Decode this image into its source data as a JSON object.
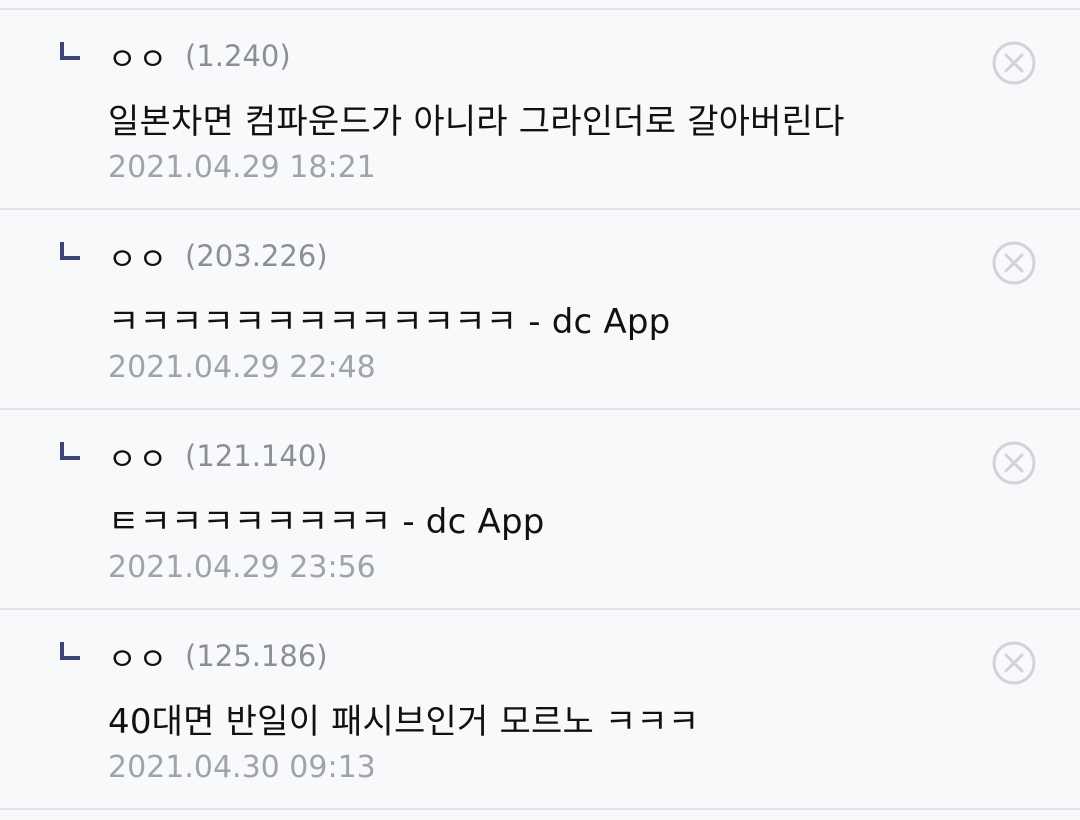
{
  "comments": [
    {
      "nickname": "ㅇㅇ",
      "ip": "(1.240)",
      "text": "일본차면 컴파운드가 아니라 그라인더로 갈아버린다",
      "timestamp": "2021.04.29 18:21",
      "reply_icon": "reply-arrow-icon",
      "delete_icon": "close-circle-icon"
    },
    {
      "nickname": "ㅇㅇ",
      "ip": "(203.226)",
      "text": "ㅋㅋㅋㅋㅋㅋㅋㅋㅋㅋㅋㅋㅋ - dc App",
      "timestamp": "2021.04.29 22:48",
      "reply_icon": "reply-arrow-icon",
      "delete_icon": "close-circle-icon"
    },
    {
      "nickname": "ㅇㅇ",
      "ip": "(121.140)",
      "text": "ㅌㅋㅋㅋㅋㅋㅋㅋㅋ - dc App",
      "timestamp": "2021.04.29 23:56",
      "reply_icon": "reply-arrow-icon",
      "delete_icon": "close-circle-icon"
    },
    {
      "nickname": "ㅇㅇ",
      "ip": "(125.186)",
      "text": "40대면 반일이 패시브인거 모르노 ㅋㅋㅋ",
      "timestamp": "2021.04.30 09:13",
      "reply_icon": "reply-arrow-icon",
      "delete_icon": "close-circle-icon"
    }
  ],
  "colors": {
    "background": "#f8f9fb",
    "divider": "#e2e4ea",
    "reply_icon": "#3d4577",
    "text": "#111111",
    "meta": "#8d8f96",
    "delete_icon": "#d2d3d7"
  }
}
